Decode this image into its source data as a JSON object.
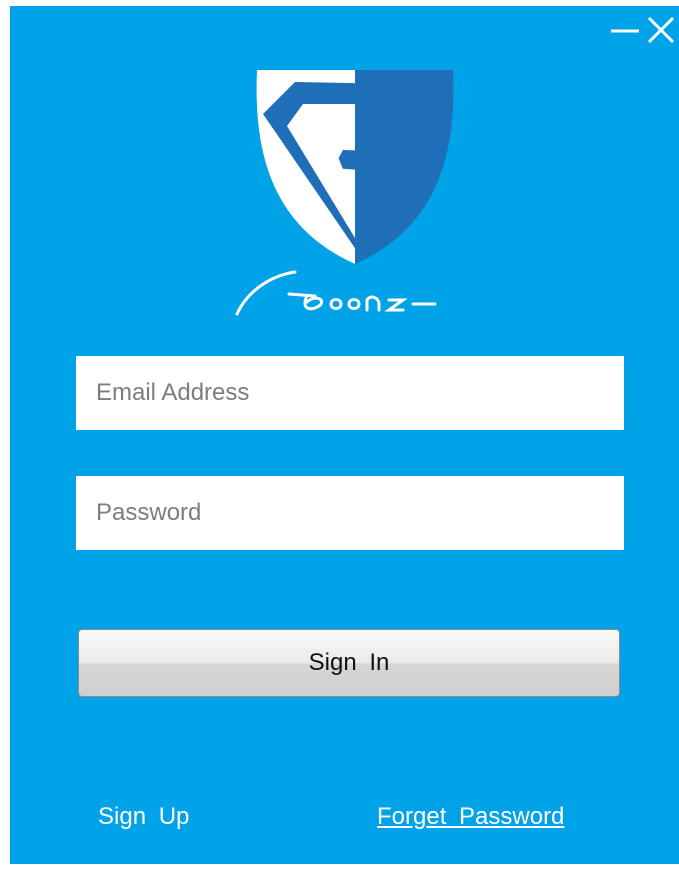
{
  "colors": {
    "background": "#00a2e8",
    "shield_dark": "#1f6fb8",
    "shield_light": "#ffffff"
  },
  "window_controls": {
    "minimize_icon": "minimize-icon",
    "close_icon": "close-icon"
  },
  "logo": {
    "icon": "shield-g-logo-icon",
    "signature": "Goonze"
  },
  "form": {
    "email": {
      "value": "",
      "placeholder": "Email Address"
    },
    "password": {
      "value": "",
      "placeholder": "Password"
    },
    "signin_label": "Sign In"
  },
  "footer": {
    "signup_label": "Sign Up",
    "forget_label": "Forget Password"
  }
}
